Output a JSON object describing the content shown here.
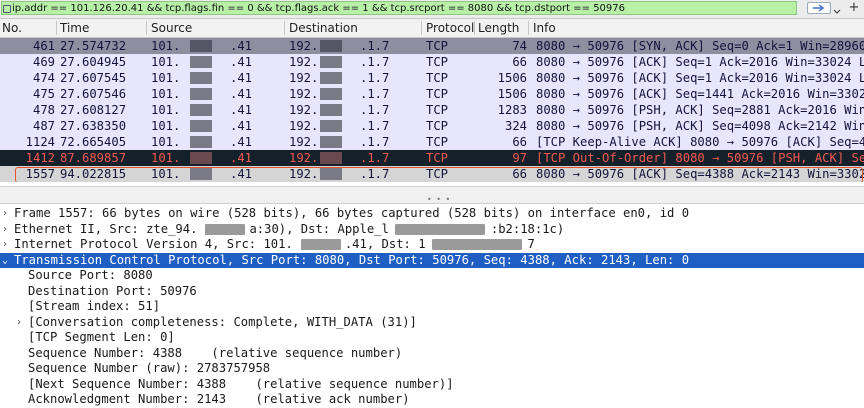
{
  "filter": {
    "expression": "ip.addr == 101.126.20.41 && tcp.flags.fin == 0 && tcp.flags.ack == 1 && tcp.srcport == 8080 && tcp.dstport == 50976"
  },
  "columns": [
    "No.",
    "Time",
    "Source",
    "Destination",
    "Protocol",
    "Length",
    "Info"
  ],
  "packets": [
    {
      "no": "461",
      "time": "27.574732",
      "src": "101.",
      "src_end": ".41",
      "dst": "192.",
      "dst_end": ".1.7",
      "proto": "TCP",
      "len": "74",
      "info": "8080 → 50976 [SYN, ACK] Seq=0 Ack=1 Win=28960"
    },
    {
      "no": "469",
      "time": "27.604945",
      "src": "101.",
      "src_end": ".41",
      "dst": "192.",
      "dst_end": ".1.7",
      "proto": "TCP",
      "len": "66",
      "info": "8080 → 50976 [ACK] Seq=1 Ack=2016 Win=33024 L"
    },
    {
      "no": "474",
      "time": "27.607545",
      "src": "101.",
      "src_end": ".41",
      "dst": "192.",
      "dst_end": ".1.7",
      "proto": "TCP",
      "len": "1506",
      "info": "8080 → 50976 [ACK] Seq=1 Ack=2016 Win=33024 L"
    },
    {
      "no": "475",
      "time": "27.607546",
      "src": "101.",
      "src_end": ".41",
      "dst": "192.",
      "dst_end": ".1.7",
      "proto": "TCP",
      "len": "1506",
      "info": "8080 → 50976 [ACK] Seq=1441 Ack=2016 Win=3302"
    },
    {
      "no": "478",
      "time": "27.608127",
      "src": "101.",
      "src_end": ".41",
      "dst": "192.",
      "dst_end": ".1.7",
      "proto": "TCP",
      "len": "1283",
      "info": "8080 → 50976 [PSH, ACK] Seq=2881 Ack=2016 Win"
    },
    {
      "no": "487",
      "time": "27.638350",
      "src": "101.",
      "src_end": ".41",
      "dst": "192.",
      "dst_end": ".1.7",
      "proto": "TCP",
      "len": "324",
      "info": "8080 → 50976 [PSH, ACK] Seq=4098 Ack=2142 Win"
    },
    {
      "no": "1124",
      "time": "72.665405",
      "src": "101.",
      "src_end": ".41",
      "dst": "192.",
      "dst_end": ".1.7",
      "proto": "TCP",
      "len": "66",
      "info": "[TCP Keep-Alive ACK] 8080 → 50976 [ACK] Seq=4"
    },
    {
      "no": "1412",
      "time": "87.689857",
      "src": "101.",
      "src_end": ".41",
      "dst": "192.",
      "dst_end": ".1.7",
      "proto": "TCP",
      "len": "97",
      "info": "[TCP Out-Of-Order] 8080 → 50976 [PSH, ACK] Se"
    },
    {
      "no": "1557",
      "time": "94.022815",
      "src": "101.",
      "src_end": ".41",
      "dst": "192.1",
      "dst_end": ".1.7",
      "proto": "TCP",
      "len": "66",
      "info": "8080 → 50976 [ACK] Seq=4388 Ack=2143 Win=3302"
    }
  ],
  "details": [
    {
      "chevron": "›",
      "indent": 0,
      "text": "Frame 1557: 66 bytes on wire (528 bits), 66 bytes captured (528 bits) on interface en0, id 0"
    },
    {
      "chevron": "›",
      "indent": 0,
      "text": "Ethernet II, Src: zte_94.",
      "text_mid": "a:30), Dst: Apple_l",
      "text_end": ":b2:18:1c)"
    },
    {
      "chevron": "›",
      "indent": 0,
      "text": "Internet Protocol Version 4, Src: 101.",
      "text_mid": ".41, Dst: 1",
      "text_end": "7"
    },
    {
      "chevron": "⌄",
      "indent": 0,
      "text": "Transmission Control Protocol, Src Port: 8080, Dst Port: 50976, Seq: 4388, Ack: 2143, Len: 0"
    },
    {
      "chevron": "",
      "indent": 1,
      "text": "Source Port: 8080"
    },
    {
      "chevron": "",
      "indent": 1,
      "text": "Destination Port: 50976"
    },
    {
      "chevron": "",
      "indent": 1,
      "text": "[Stream index: 51]"
    },
    {
      "chevron": "›",
      "indent": 1,
      "text": "[Conversation completeness: Complete, WITH_DATA (31)]"
    },
    {
      "chevron": "",
      "indent": 1,
      "text": "[TCP Segment Len: 0]"
    },
    {
      "chevron": "",
      "indent": 1,
      "text": "Sequence Number: 4388    (relative sequence number)"
    },
    {
      "chevron": "",
      "indent": 1,
      "text": "Sequence Number (raw): 2783757958"
    },
    {
      "chevron": "",
      "indent": 1,
      "text": "[Next Sequence Number: 4388    (relative sequence number)]"
    },
    {
      "chevron": "",
      "indent": 1,
      "text": "Acknowledgment Number: 2143    (relative ack number)"
    }
  ]
}
